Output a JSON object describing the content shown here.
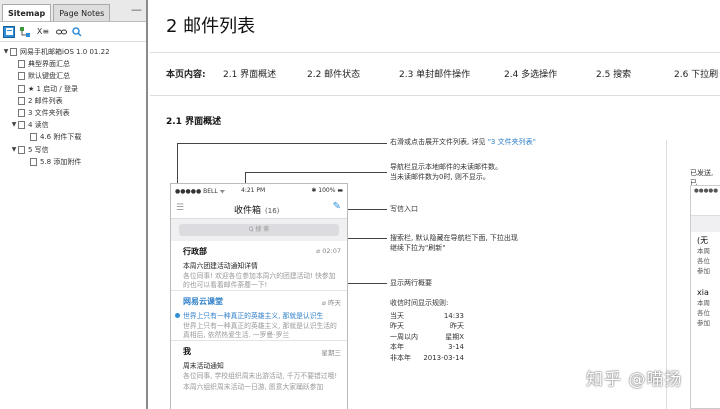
{
  "sidebar": {
    "tabs": [
      "Sitemap",
      "Page Notes"
    ],
    "collapse_icon": "minus-icon",
    "toolbar": [
      "sitemap-icon",
      "tree-icon",
      "X≡",
      "link-icon",
      "search-icon"
    ],
    "toolbar_text": "X≡",
    "tree": [
      {
        "label": "网易手机邮箱iOS 1.0 01.22",
        "level": 0,
        "expanded": true
      },
      {
        "label": "典型界面汇总",
        "level": 1
      },
      {
        "label": "默认键盘汇总",
        "level": 1
      },
      {
        "label": "★ 1 启动 / 登录",
        "level": 1
      },
      {
        "label": "2 邮件列表",
        "level": 1
      },
      {
        "label": "3 文件夹列表",
        "level": 1
      },
      {
        "label": "4 读信",
        "level": 1,
        "expanded": true
      },
      {
        "label": "4.6 附件下载",
        "level": 2
      },
      {
        "label": "5 写信",
        "level": 1,
        "expanded": true
      },
      {
        "label": "5.8 添加附件",
        "level": 2
      }
    ]
  },
  "main": {
    "title": "2  邮件列表",
    "nav_label": "本页内容:",
    "nav_items": [
      "2.1  界面概述",
      "2.2  邮件状态",
      "2.3  单封邮件操作",
      "2.4  多选操作",
      "2.5  搜索",
      "2.6  下拉刷"
    ],
    "section_title": "2.1  界面概述",
    "phone": {
      "status_left": "●●●●● BELL  ᯤ",
      "status_time": "4:21 PM",
      "status_right": "✱ 100% ▬",
      "title": "收件箱",
      "count": "(16)",
      "search_placeholder": "Q 搜 索",
      "mails": [
        {
          "from": "行政部",
          "date": "02:07",
          "subject": "本周六团建活动通知详情",
          "preview": "各位同事! 欢迎各位参加本周六的团建活动! 快参加的也可以看着邮件荼蘼一下!",
          "unread": false,
          "clip": true
        },
        {
          "from": "网易云课堂",
          "date": "昨天",
          "subject": "世界上只有一种真正的英雄主义, 那就是认识生",
          "preview": "世界上只有一种真正的英雄主义, 那就是认识生活的真相后, 依然热爱生活. 一罗曼-罗兰",
          "unread": true,
          "clip": true
        },
        {
          "from": "我",
          "date": "星期三",
          "subject": "周末活动通知",
          "preview": "各位同事, 学校组织周末出游活动, 千万不要错过哦!",
          "unread": false,
          "clip": false
        },
        {
          "from": "",
          "date": "",
          "subject": "",
          "preview": "本周六组织周末活动一日游, 愿意大家踊跃参加",
          "unread": false,
          "clip": false
        }
      ]
    },
    "annotations": {
      "a1_prefix": "右滑或点击展开文件列表, 详见 ",
      "a1_link": "\"3 文件夹列表\"",
      "a2_line1": "导航栏显示本地邮件的未读邮件数。",
      "a2_line2": "当未读邮件数为0时, 则不显示。",
      "a3": "写信入口",
      "a4_line1": "搜索栏, 默认隐藏在导航栏下面, 下拉出现",
      "a4_line2": "继续下拉为\"刷新\"",
      "a5": "显示两行概要",
      "times_title": "收信时间显示规则:",
      "times": [
        {
          "k": "当天",
          "v": "14:33"
        },
        {
          "k": "昨天",
          "v": "昨天"
        },
        {
          "k": "一周以内",
          "v": "星期X"
        },
        {
          "k": "本年",
          "v": "3-14"
        },
        {
          "k": "非本年",
          "v": "2013-03-14"
        }
      ]
    },
    "right_cut": {
      "header": "已发送, 已",
      "status": "●●●●● B",
      "lines": [
        "(无",
        "本周",
        "各位",
        "参加",
        "xia",
        "本周",
        "各位",
        "参加"
      ]
    },
    "watermark": "知乎 @喵扬"
  }
}
